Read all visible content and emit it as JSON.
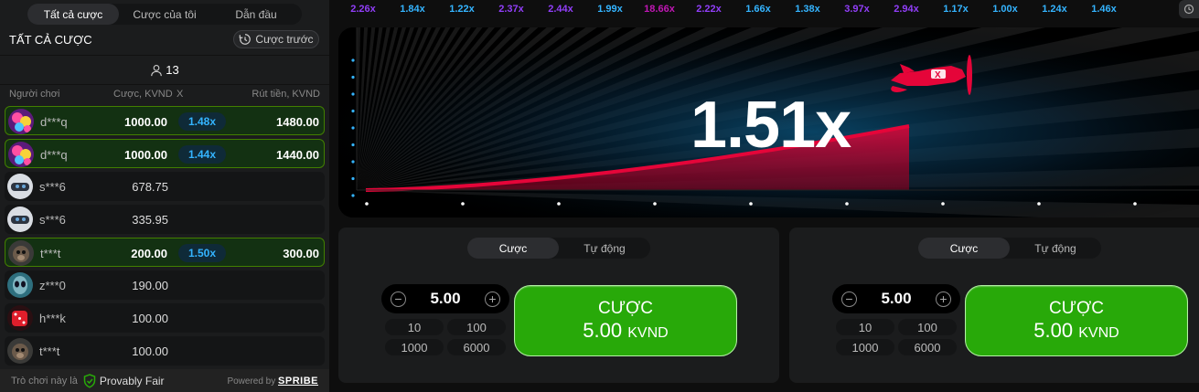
{
  "sidebar": {
    "tabs": [
      "Tất cả cược",
      "Cược của tôi",
      "Dẫn đầu"
    ],
    "title": "TẤT CẢ CƯỢC",
    "prev_button": "Cược trước",
    "player_count": "13",
    "columns": {
      "player": "Người chơi",
      "bet": "Cược, KVND",
      "mult": "X",
      "cashout": "Rút tiền, KVND"
    },
    "rows": [
      {
        "name": "d***q",
        "bet": "1000.00",
        "mult": "1.48x",
        "cashout": "1480.00",
        "won": true,
        "avatar": "pink-flower-avatar"
      },
      {
        "name": "d***q",
        "bet": "1000.00",
        "mult": "1.44x",
        "cashout": "1440.00",
        "won": true,
        "avatar": "pink-flower-avatar"
      },
      {
        "name": "s***6",
        "bet": "678.75",
        "mult": "",
        "cashout": "",
        "won": false,
        "avatar": "vr-headset-avatar"
      },
      {
        "name": "s***6",
        "bet": "335.95",
        "mult": "",
        "cashout": "",
        "won": false,
        "avatar": "vr-headset-avatar"
      },
      {
        "name": "t***t",
        "bet": "200.00",
        "mult": "1.50x",
        "cashout": "300.00",
        "won": true,
        "avatar": "monkey-avatar"
      },
      {
        "name": "z***0",
        "bet": "190.00",
        "mult": "",
        "cashout": "",
        "won": false,
        "avatar": "alien-avatar"
      },
      {
        "name": "h***k",
        "bet": "100.00",
        "mult": "",
        "cashout": "",
        "won": false,
        "avatar": "dice-avatar"
      },
      {
        "name": "t***t",
        "bet": "100.00",
        "mult": "",
        "cashout": "",
        "won": false,
        "avatar": "monkey-avatar"
      }
    ],
    "footer": {
      "label": "Trò chơi này là",
      "badge": "Provably Fair",
      "powered": "Powered by",
      "brand": "SPRIBE"
    }
  },
  "history": [
    {
      "v": "2.26x",
      "c": "v"
    },
    {
      "v": "1.84x",
      "c": "b"
    },
    {
      "v": "1.22x",
      "c": "b"
    },
    {
      "v": "2.37x",
      "c": "v"
    },
    {
      "v": "2.44x",
      "c": "v"
    },
    {
      "v": "1.99x",
      "c": "b"
    },
    {
      "v": "18.66x",
      "c": "m"
    },
    {
      "v": "2.22x",
      "c": "v"
    },
    {
      "v": "1.66x",
      "c": "b"
    },
    {
      "v": "1.38x",
      "c": "b"
    },
    {
      "v": "3.97x",
      "c": "v"
    },
    {
      "v": "2.94x",
      "c": "v"
    },
    {
      "v": "1.17x",
      "c": "b"
    },
    {
      "v": "1.00x",
      "c": "b"
    },
    {
      "v": "1.24x",
      "c": "b"
    },
    {
      "v": "1.46x",
      "c": "b"
    }
  ],
  "game": {
    "multiplier": "1.51x",
    "progress": 0.66
  },
  "panels": [
    {
      "tabs": [
        "Cược",
        "Tự động"
      ],
      "value": "5.00",
      "quick": [
        "10",
        "100",
        "1000",
        "6000"
      ],
      "cta_title": "CƯỢC",
      "cta_amount": "5.00",
      "cta_currency": "KVND"
    },
    {
      "tabs": [
        "Cược",
        "Tự động"
      ],
      "value": "5.00",
      "quick": [
        "10",
        "100",
        "1000",
        "6000"
      ],
      "cta_title": "CƯỢC",
      "cta_amount": "5.00",
      "cta_currency": "KVND"
    }
  ],
  "colors": {
    "accent_green": "#28a909",
    "curve_red": "#e50539",
    "mult_blue": "#34b4ff",
    "mult_violet": "#913ef8",
    "mult_magenta": "#c017b4"
  }
}
